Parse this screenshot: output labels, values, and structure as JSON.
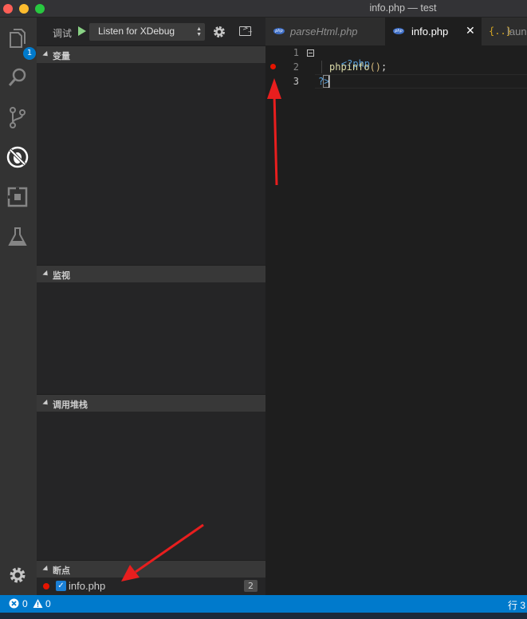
{
  "window": {
    "title": "info.php — test"
  },
  "activity_bar": {
    "explorer_badge": "1",
    "icons": [
      "files-icon",
      "search-icon",
      "source-control-icon",
      "debug-icon",
      "extensions-icon",
      "flask-icon",
      "gear-icon"
    ]
  },
  "debug_toolbar": {
    "label": "调试",
    "config_selected": "Listen for XDebug"
  },
  "sections": {
    "variables": "变量",
    "watch": "监视",
    "call_stack": "调用堆栈",
    "breakpoints": "断点"
  },
  "breakpoint_item": {
    "file": "info.php",
    "line": "2"
  },
  "tabs": [
    {
      "label": "parseHtml.php"
    },
    {
      "label": "info.php",
      "close": "✕"
    },
    {
      "label": "launch.json",
      "icon": "{..}"
    }
  ],
  "editor": {
    "line_numbers": [
      "1",
      "2",
      "3"
    ],
    "lines": {
      "l1_open": "<?php",
      "l2_fn": "phpinfo",
      "l2_parens": "()",
      "l2_semi": ";",
      "l3_close_q": "?",
      "l3_close_gt": ">"
    }
  },
  "status_bar": {
    "errors": "0",
    "warnings": "0",
    "position": "行 3"
  },
  "colors": {
    "accent": "#007acc",
    "breakpoint": "#e51400",
    "annotation_arrow": "#e81e1e"
  }
}
